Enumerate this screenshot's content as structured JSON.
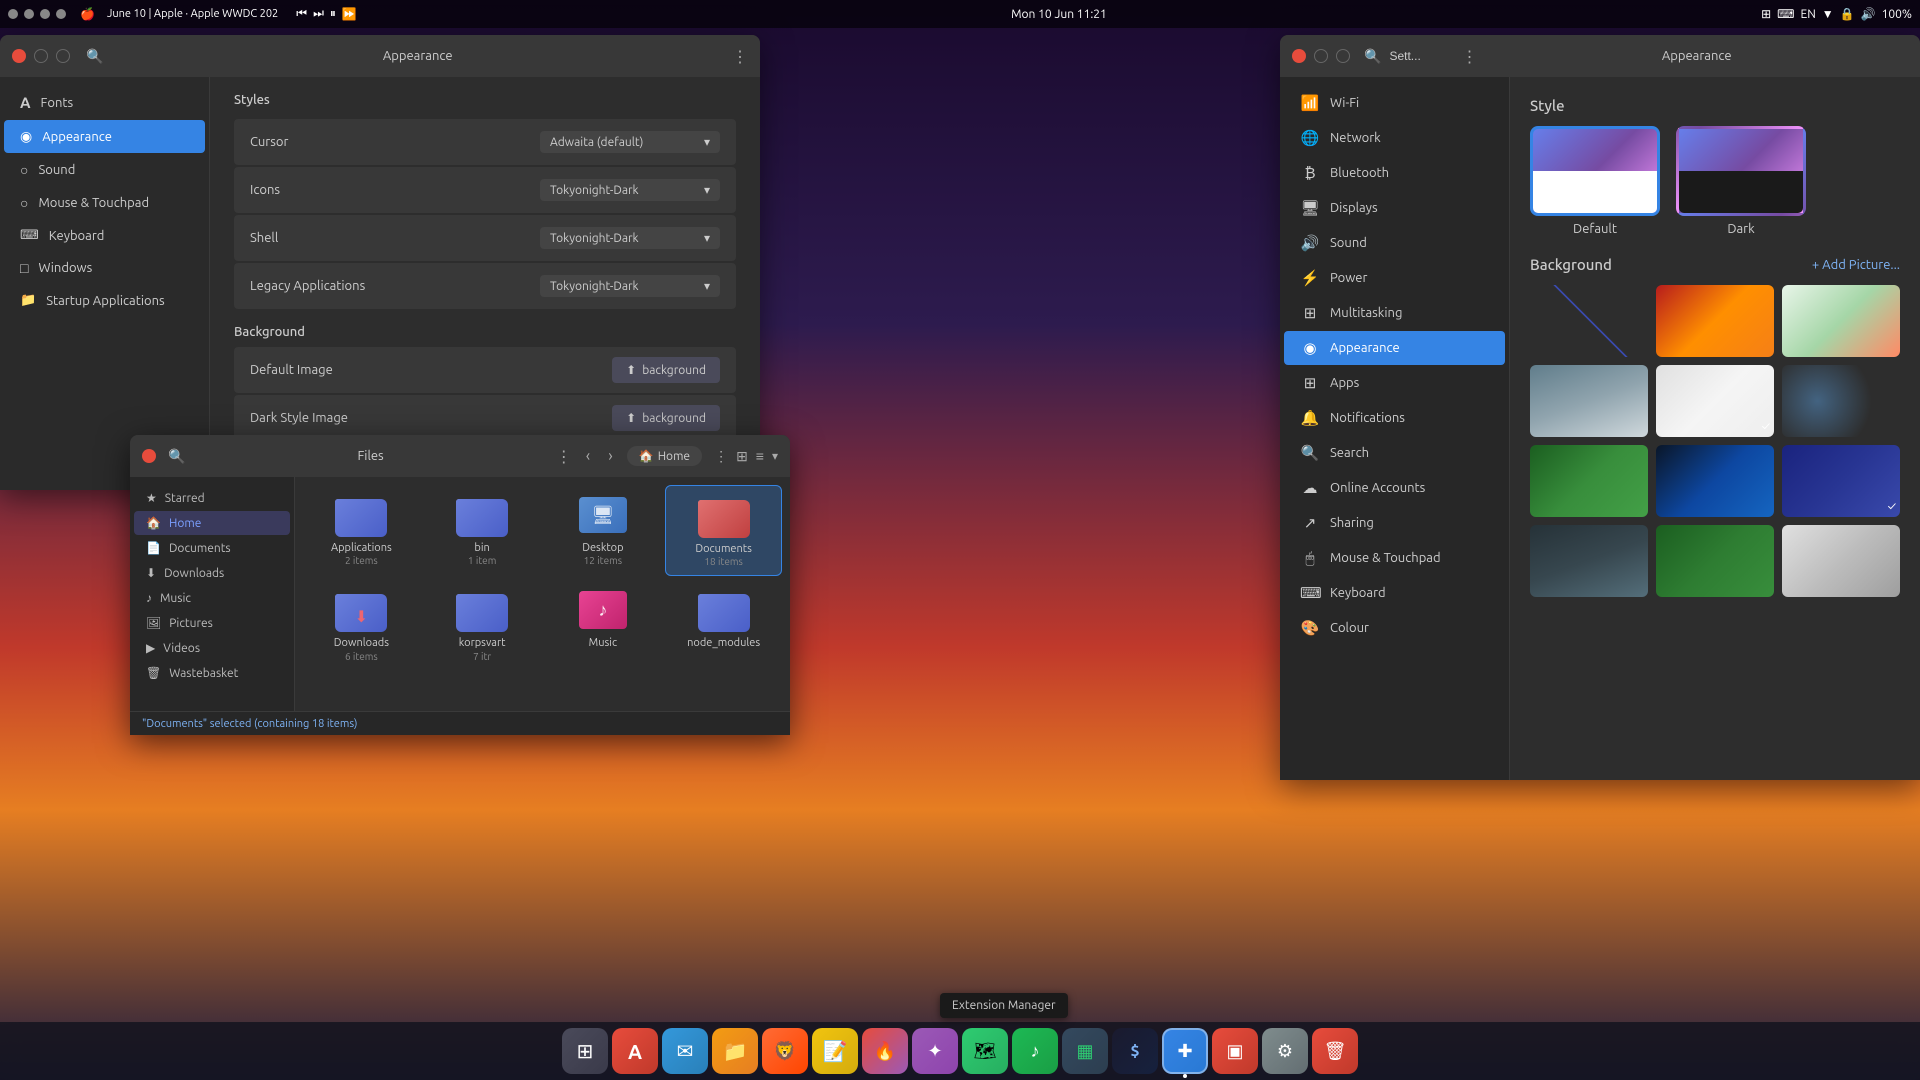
{
  "desktop": {
    "bg_description": "city sunset background"
  },
  "topbar": {
    "left_items": [
      "●",
      "●",
      "●",
      "●"
    ],
    "apple_text": "🍎",
    "event_text": "June 10 | Apple · Apple WWDC 202",
    "media_controls": [
      "⏮",
      "⏭",
      "⏸",
      "⏩"
    ],
    "center_text": "Mon 10 Jun 11:21",
    "right_icons": [
      "⊞",
      "⌨",
      "EN",
      "▼",
      "🔒",
      "🔊",
      "100%"
    ]
  },
  "tweaks_window": {
    "title": "Appearance",
    "search_label": "Search",
    "menu_label": "Menu",
    "sidebar": {
      "items": [
        {
          "id": "fonts",
          "label": "Fonts",
          "icon": "A"
        },
        {
          "id": "appearance",
          "label": "Appearance",
          "icon": "◉",
          "active": true
        },
        {
          "id": "sound",
          "label": "Sound",
          "icon": "○"
        },
        {
          "id": "mouse",
          "label": "Mouse & Touchpad",
          "icon": "○"
        },
        {
          "id": "keyboard",
          "label": "Keyboard",
          "icon": "⌨"
        },
        {
          "id": "windows",
          "label": "Windows",
          "icon": "□"
        },
        {
          "id": "startup",
          "label": "Startup Applications",
          "icon": "📁"
        }
      ]
    },
    "content": {
      "styles_title": "Styles",
      "rows": [
        {
          "label": "Cursor",
          "value": "Adwaita (default)"
        },
        {
          "label": "Icons",
          "value": "Tokyonight-Dark"
        },
        {
          "label": "Shell",
          "value": "Tokyonight-Dark"
        },
        {
          "label": "Legacy Applications",
          "value": "Tokyonight-Dark"
        }
      ],
      "background_title": "Background",
      "bg_rows": [
        {
          "label": "Default Image",
          "btn_label": "background"
        },
        {
          "label": "Dark Style Image",
          "btn_label": "background"
        }
      ]
    }
  },
  "files_window": {
    "title": "Files",
    "breadcrumb_icon": "🏠",
    "breadcrumb_label": "Home",
    "sidebar": {
      "items": [
        {
          "id": "starred",
          "label": "Starred",
          "icon": "★",
          "section": false
        },
        {
          "id": "home",
          "label": "Home",
          "icon": "🏠",
          "active": true
        },
        {
          "id": "documents",
          "label": "Documents",
          "icon": "📄"
        },
        {
          "id": "downloads",
          "label": "Downloads",
          "icon": "⬇"
        },
        {
          "id": "music",
          "label": "Music",
          "icon": "♪"
        },
        {
          "id": "pictures",
          "label": "Pictures",
          "icon": "🖼"
        },
        {
          "id": "videos",
          "label": "Videos",
          "icon": "▶"
        },
        {
          "id": "wastebasket",
          "label": "Wastebasket",
          "icon": "🗑"
        }
      ]
    },
    "items": [
      {
        "name": "Applications",
        "count": "2 items",
        "type": "folder"
      },
      {
        "name": "bin",
        "count": "1 item",
        "type": "folder"
      },
      {
        "name": "Desktop",
        "count": "12 items",
        "type": "desktop"
      },
      {
        "name": "Documents",
        "count": "18 items",
        "type": "folder-special",
        "selected": true
      },
      {
        "name": "Downloads",
        "count": "6 items",
        "type": "folder-download"
      },
      {
        "name": "korpsvart",
        "count": "7 itr",
        "type": "folder"
      },
      {
        "name": "Music",
        "count": "",
        "type": "folder-music"
      },
      {
        "name": "node_modules",
        "count": "",
        "type": "folder"
      }
    ],
    "statusbar": "\"Documents\" selected (containing 18 items)"
  },
  "settings_window": {
    "title": "Appearance",
    "search_placeholder": "Sett...",
    "sidebar": {
      "items": [
        {
          "id": "wifi",
          "label": "Wi-Fi",
          "icon": "wifi"
        },
        {
          "id": "network",
          "label": "Network",
          "icon": "network"
        },
        {
          "id": "bluetooth",
          "label": "Bluetooth",
          "icon": "bluetooth"
        },
        {
          "id": "displays",
          "label": "Displays",
          "icon": "display"
        },
        {
          "id": "sound",
          "label": "Sound",
          "icon": "sound"
        },
        {
          "id": "power",
          "label": "Power",
          "icon": "power"
        },
        {
          "id": "multitasking",
          "label": "Multitasking",
          "icon": "multitasking"
        },
        {
          "id": "appearance",
          "label": "Appearance",
          "icon": "appearance",
          "active": true
        },
        {
          "id": "apps",
          "label": "Apps",
          "icon": "apps"
        },
        {
          "id": "notifications",
          "label": "Notifications",
          "icon": "notifications"
        },
        {
          "id": "search",
          "label": "Search",
          "icon": "search"
        },
        {
          "id": "online-accounts",
          "label": "Online Accounts",
          "icon": "accounts"
        },
        {
          "id": "sharing",
          "label": "Sharing",
          "icon": "sharing"
        },
        {
          "id": "mouse",
          "label": "Mouse & Touchpad",
          "icon": "mouse"
        },
        {
          "id": "keyboard",
          "label": "Keyboard",
          "icon": "keyboard"
        },
        {
          "id": "colour",
          "label": "Colour",
          "icon": "colour"
        }
      ]
    },
    "content": {
      "style_title": "Style",
      "styles": [
        {
          "id": "default",
          "label": "Default",
          "selected": true
        },
        {
          "id": "dark",
          "label": "Dark",
          "selected": false
        }
      ],
      "background_title": "Background",
      "add_picture_label": "+ Add Picture...",
      "bg_count": 12
    }
  },
  "tooltip": {
    "text": "Extension Manager"
  },
  "dock": {
    "items": [
      {
        "id": "app-launcher",
        "icon": "⊞",
        "label": "App Launcher"
      },
      {
        "id": "app-store",
        "icon": "A",
        "label": "App Store"
      },
      {
        "id": "mail",
        "icon": "✉",
        "label": "Mail"
      },
      {
        "id": "files",
        "icon": "📁",
        "label": "Files"
      },
      {
        "id": "brave",
        "icon": "🦁",
        "label": "Brave"
      },
      {
        "id": "note",
        "icon": "📝",
        "label": "Notes"
      },
      {
        "id": "torch",
        "icon": "🔥",
        "label": "Tor Browser"
      },
      {
        "id": "figma",
        "icon": "✦",
        "label": "Figma"
      },
      {
        "id": "maps",
        "icon": "🗺",
        "label": "Maps"
      },
      {
        "id": "spotify",
        "icon": "♪",
        "label": "Spotify"
      },
      {
        "id": "btop",
        "icon": "▦",
        "label": "Btop"
      },
      {
        "id": "warp",
        "icon": "$",
        "label": "Warp"
      },
      {
        "id": "ext",
        "icon": "✚",
        "label": "Extension Manager"
      },
      {
        "id": "mosaic",
        "icon": "▣",
        "label": "Mosaic"
      },
      {
        "id": "settings",
        "icon": "⚙",
        "label": "Settings"
      },
      {
        "id": "trash",
        "icon": "🗑",
        "label": "Trash"
      }
    ]
  }
}
